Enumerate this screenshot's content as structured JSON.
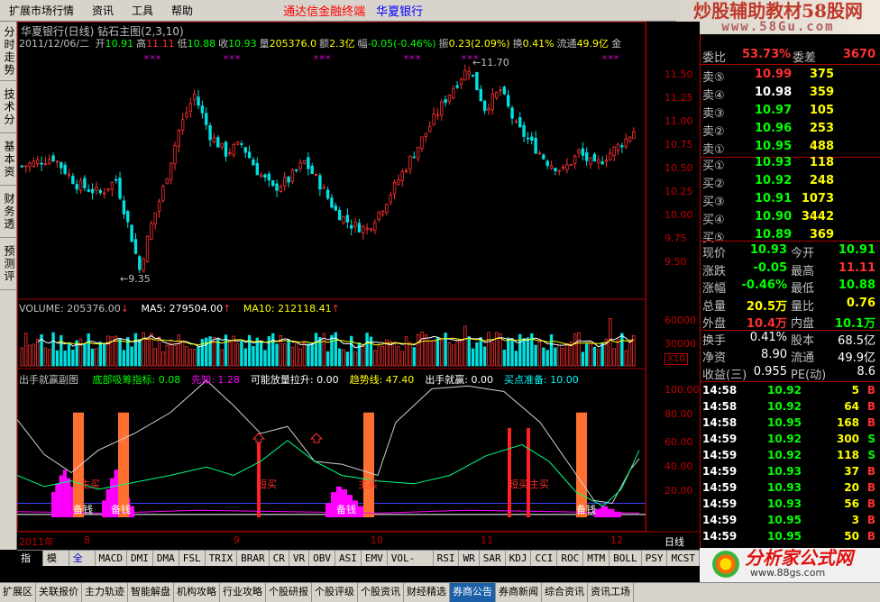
{
  "menubar": {
    "items": [
      "扩展市场行情",
      "资讯",
      "工具",
      "帮助"
    ],
    "banner": "通达信金融终端",
    "stock": "华夏银行"
  },
  "logo": {
    "title": "炒股辅助教材58股网",
    "url": "www.58Gu.com"
  },
  "sidetabs": [
    "分时走势",
    "技术分析",
    "基本资料",
    "财务透视",
    "预测评级"
  ],
  "main": {
    "title": "华夏银行(日线)  钻石主图(2,3,10)",
    "date": "2011/12/06/二",
    "ohlc": [
      {
        "label": "开",
        "value": "10.91",
        "color": "#00ff00"
      },
      {
        "label": "高",
        "value": "11.11",
        "color": "#ff3030"
      },
      {
        "label": "低",
        "value": "10.88",
        "color": "#00ff00"
      },
      {
        "label": "收",
        "value": "10.93",
        "color": "#00ff00"
      },
      {
        "label": "量",
        "value": "205376.0",
        "color": "#ffff00"
      },
      {
        "label": "额",
        "value": "2.3亿",
        "color": "#ffff00"
      },
      {
        "label": "幅",
        "value": "-0.05(-0.46%)",
        "color": "#00ff00"
      },
      {
        "label": "振",
        "value": "0.23(2.09%)",
        "color": "#ffff00"
      },
      {
        "label": "换",
        "value": "0.41%",
        "color": "#ffff00"
      },
      {
        "label": "流通",
        "value": "49.9亿",
        "color": "#ffff00"
      },
      {
        "label": "金",
        "value": "",
        "color": "#ffff00"
      }
    ],
    "high_mark": "11.70",
    "low_mark": "9.35",
    "price_axis": [
      "11.50",
      "11.25",
      "11.00",
      "10.75",
      "10.50",
      "10.25",
      "10.00",
      "9.75",
      "9.50"
    ]
  },
  "volume": {
    "label": "VOLUME: 205376.00",
    "ma5": "MA5: 279504.00",
    "ma10": "MA10: 212118.41",
    "axis": [
      "60000",
      "30000",
      "X10"
    ]
  },
  "indicator": {
    "name": "出手就赢副图",
    "items": [
      {
        "text": "底部吸筹指标: 0.08",
        "color": "#00ff00"
      },
      {
        "text": "先知: 1.28",
        "color": "#ff00ff"
      },
      {
        "text": "可能放量拉升: 0.00",
        "color": "#ffffff"
      },
      {
        "text": "趋势线: 47.40",
        "color": "#ffff00"
      },
      {
        "text": "出手就赢: 0.00",
        "color": "#ffffff"
      },
      {
        "text": "买点准备: 10.00",
        "color": "#00ffff"
      }
    ],
    "axis": [
      "100.00",
      "80.00",
      "60.00",
      "40.00",
      "20.00"
    ],
    "labels": [
      "主买",
      "备钱",
      "备钱",
      "短买",
      "备钱",
      "主买",
      "短买",
      "主买",
      "备钱"
    ]
  },
  "timeaxis": {
    "labels": [
      "2011年",
      "8",
      "9",
      "10",
      "11",
      "12"
    ],
    "period": "日线"
  },
  "quote": {
    "wei": {
      "label": "委比",
      "value": "53.73%",
      "label2": "委差",
      "value2": "3670"
    },
    "sell": [
      {
        "label": "卖⑤",
        "price": "10.99",
        "vol": "375"
      },
      {
        "label": "卖④",
        "price": "10.98",
        "vol": "359"
      },
      {
        "label": "卖③",
        "price": "10.97",
        "vol": "105"
      },
      {
        "label": "卖②",
        "price": "10.96",
        "vol": "253"
      },
      {
        "label": "卖①",
        "price": "10.95",
        "vol": "488"
      }
    ],
    "buy": [
      {
        "label": "买①",
        "price": "10.93",
        "vol": "118"
      },
      {
        "label": "买②",
        "price": "10.92",
        "vol": "248"
      },
      {
        "label": "买③",
        "price": "10.91",
        "vol": "1073"
      },
      {
        "label": "买④",
        "price": "10.90",
        "vol": "3442"
      },
      {
        "label": "买⑤",
        "price": "10.89",
        "vol": "369"
      }
    ],
    "stats": [
      {
        "l1": "现价",
        "v1": "10.93",
        "c1": "#00ff00",
        "l2": "今开",
        "v2": "10.91",
        "c2": "#00ff00"
      },
      {
        "l1": "涨跌",
        "v1": "-0.05",
        "c1": "#00ff00",
        "l2": "最高",
        "v2": "11.11",
        "c2": "#ff3030"
      },
      {
        "l1": "涨幅",
        "v1": "-0.46%",
        "c1": "#00ff00",
        "l2": "最低",
        "v2": "10.88",
        "c2": "#00ff00"
      },
      {
        "l1": "总量",
        "v1": "20.5万",
        "c1": "#ffff00",
        "l2": "量比",
        "v2": "0.76",
        "c2": "#ffff00"
      },
      {
        "l1": "外盘",
        "v1": "10.4万",
        "c1": "#ff3030",
        "l2": "内盘",
        "v2": "10.1万",
        "c2": "#00ff00"
      }
    ],
    "fund": [
      {
        "l1": "换手",
        "v1": "0.41%",
        "l2": "股本",
        "v2": "68.5亿"
      },
      {
        "l1": "净资",
        "v1": "8.90",
        "l2": "流通",
        "v2": "49.9亿"
      },
      {
        "l1": "收益(三)",
        "v1": "0.955",
        "l2": "PE(动)",
        "v2": "8.6"
      }
    ],
    "ticks": [
      {
        "time": "14:58",
        "price": "10.92",
        "vol": "5",
        "side": "B"
      },
      {
        "time": "14:58",
        "price": "10.92",
        "vol": "64",
        "side": "B"
      },
      {
        "time": "14:58",
        "price": "10.95",
        "vol": "168",
        "side": "B"
      },
      {
        "time": "14:59",
        "price": "10.92",
        "vol": "300",
        "side": "S"
      },
      {
        "time": "14:59",
        "price": "10.92",
        "vol": "118",
        "side": "S"
      },
      {
        "time": "14:59",
        "price": "10.93",
        "vol": "37",
        "side": "B"
      },
      {
        "time": "14:59",
        "price": "10.93",
        "vol": "20",
        "side": "B"
      },
      {
        "time": "14:59",
        "price": "10.93",
        "vol": "56",
        "side": "B"
      },
      {
        "time": "14:59",
        "price": "10.95",
        "vol": "3",
        "side": "B"
      },
      {
        "time": "14:59",
        "price": "10.95",
        "vol": "50",
        "side": "B"
      }
    ]
  },
  "indtabs": [
    "指标",
    "模板",
    "全部",
    "MACD",
    "DMI",
    "DMA",
    "FSL",
    "TRIX",
    "BRAR",
    "CR",
    "VR",
    "OBV",
    "ASI",
    "EMV",
    "VOL-TDX",
    "RSI",
    "WR",
    "SAR",
    "KDJ",
    "CCI",
    "ROC",
    "MTM",
    "BOLL",
    "PSY",
    "MCST"
  ],
  "navtabs": [
    "扩展区",
    "关联报价",
    "主力轨迹",
    "智能解盘",
    "机构攻略",
    "行业攻略",
    "个股研报",
    "个股评级",
    "个股资讯",
    "财经精选",
    "券商公告",
    "券商新闻",
    "综合资讯",
    "资讯工场"
  ],
  "brand2": {
    "title": "分析家公式网",
    "url": "www.88gs.com"
  },
  "colors": {
    "up": "#ff3030",
    "down": "#00e0e0",
    "volma5": "#ffffff",
    "volma10": "#ffff00"
  }
}
